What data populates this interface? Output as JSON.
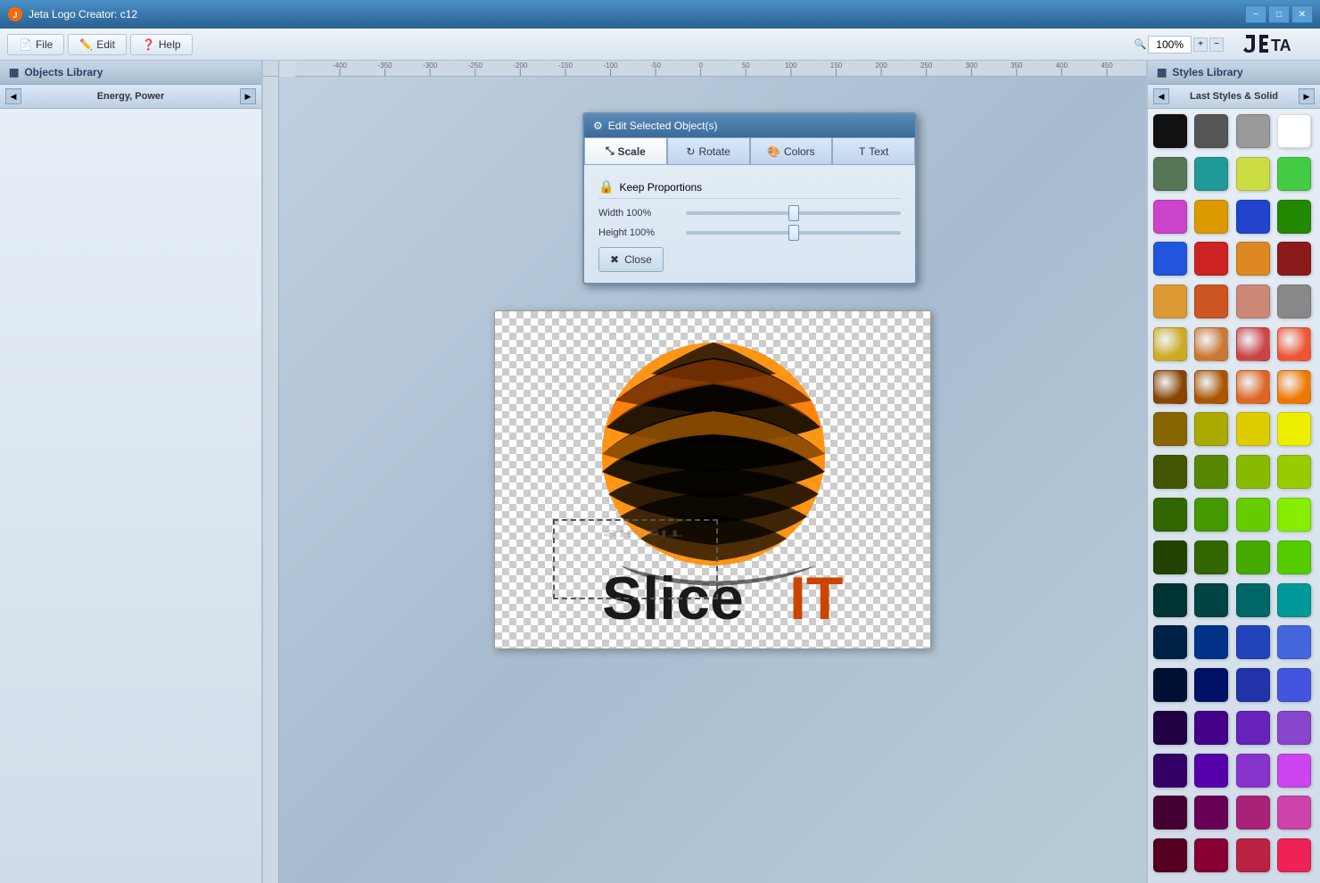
{
  "app": {
    "title": "Jeta Logo Creator: c12",
    "zoom": "100%"
  },
  "titlebar": {
    "minimize": "−",
    "maximize": "□",
    "close": "✕"
  },
  "menu": {
    "file": "File",
    "edit": "Edit",
    "help": "Help"
  },
  "objects_library": {
    "title": "Objects Library",
    "category": "Energy, Power"
  },
  "styles_library": {
    "title": "Styles Library",
    "category": "Last Styles & Solid"
  },
  "edit_dialog": {
    "title": "Edit Selected Object(s)",
    "tabs": {
      "scale": "Scale",
      "rotate": "Rotate",
      "colors": "Colors",
      "text": "Text"
    },
    "keep_proportions": "Keep Proportions",
    "width_label": "Width 100%",
    "height_label": "Height 100%",
    "close": "Close"
  },
  "colors": [
    "#111111",
    "#555555",
    "#999999",
    "#ffffff",
    "#557755",
    "#229999",
    "#ccdd44",
    "#44cc44",
    "#cc44cc",
    "#dd9900",
    "#2244cc",
    "#228800",
    "#2255dd",
    "#cc2222",
    "#dd8822",
    "#8b1a1a",
    "#dd9933",
    "#cc5522",
    "#cc8877",
    "#888888",
    "#ccaa22",
    "#cc7733",
    "#cc4444",
    "#ee5533",
    "#884400",
    "#aa5500",
    "#dd6622",
    "#ee7700",
    "#886600",
    "#aaaa00",
    "#ddcc00",
    "#eeee00",
    "#445500",
    "#558800",
    "#88bb00",
    "#99cc00",
    "#336600",
    "#449900",
    "#66cc00",
    "#88ee00",
    "#224400",
    "#336600",
    "#44aa00",
    "#55cc00",
    "#003333",
    "#004444",
    "#006666",
    "#009999",
    "#002244",
    "#003388",
    "#2244bb",
    "#4466dd",
    "#001133",
    "#001166",
    "#2233aa",
    "#4455dd",
    "#220044",
    "#440088",
    "#6622bb",
    "#8844cc",
    "#330066",
    "#5500aa",
    "#8833cc",
    "#cc44ee",
    "#440033",
    "#660055",
    "#aa2277",
    "#cc44aa",
    "#550022",
    "#880033",
    "#bb2244",
    "#ee2255"
  ]
}
